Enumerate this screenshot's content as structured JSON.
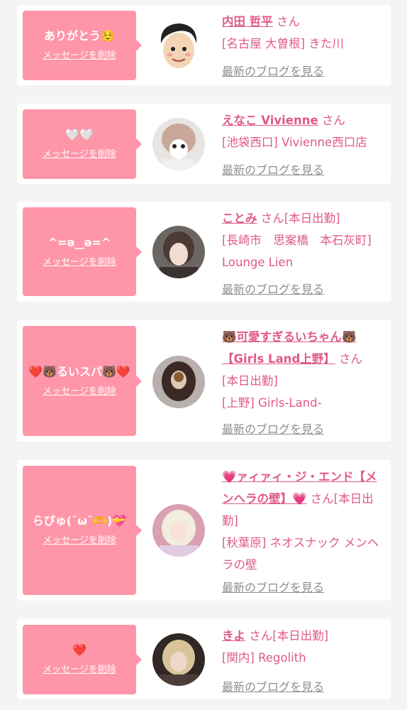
{
  "common": {
    "delete_label": "メッセージを削除",
    "blog_label": "最新のブログを見る",
    "san": "さん"
  },
  "entries": [
    {
      "message": "ありがとう☺️",
      "name": "内田 哲平",
      "status": "",
      "shop": "[名古屋 大曽根] きた川",
      "avatar_icon": "illustrated-man-avatar"
    },
    {
      "message": "🤍🤍",
      "name": "えなこ Vivienne",
      "status": "",
      "shop": "[池袋西口] Vivienne西口店",
      "avatar_icon": "girl-photo-avatar"
    },
    {
      "message": "^=ə‿ə=^",
      "name": "ことみ",
      "status": "[本日出勤]",
      "shop": "[長崎市　思案橋　本石灰町] Lounge Lien",
      "avatar_icon": "girl-photo-avatar"
    },
    {
      "message": "❤️🐻るいスパ🐻❤️",
      "name": "🐻可愛すぎるいちゃん🐻【Girls Land上野】",
      "status": "[本日出勤]",
      "shop": "[上野] Girls-Land-",
      "avatar_icon": "girl-photo-avatar"
    },
    {
      "message": "らぴゅ(˘ω˘🫶)💝",
      "name": "💗ァィァィ・ジ・エンド【メンヘラの壁】💗",
      "status": "[本日出勤]",
      "shop": "[秋葉原] ネオスナック メンヘラの壁",
      "avatar_icon": "girl-photo-avatar"
    },
    {
      "message": "❤️",
      "name": "きよ",
      "status": "[本日出勤]",
      "shop": "[関内] Regolith",
      "avatar_icon": "girl-photo-avatar"
    }
  ]
}
